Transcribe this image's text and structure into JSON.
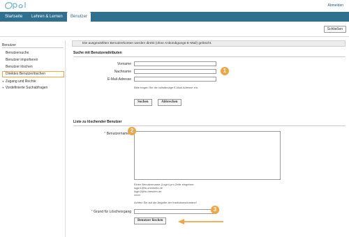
{
  "header": {
    "logo_text": "Opal",
    "logout_label": "Abmelden"
  },
  "nav": {
    "tabs": [
      {
        "label": "Startseite"
      },
      {
        "label": "Lehren & Lernen"
      },
      {
        "label": "Benutzer"
      }
    ]
  },
  "toolbar": {
    "close_label": "Schließen"
  },
  "sidebar": {
    "heading": "Benutzer",
    "items": [
      {
        "label": "Benutzersuche"
      },
      {
        "label": "Benutzer importieren"
      },
      {
        "label": "Benutzer löschen"
      },
      {
        "label": "Direktes Benutzerlöschen"
      }
    ],
    "groups": [
      {
        "toggle": "+",
        "label": "Zugang und Rechte"
      },
      {
        "toggle": "+",
        "label": "Vordefinierte Suchabfragen"
      }
    ]
  },
  "main": {
    "info_text": "Die ausgewählten Benutzerkonten werden direkt (ohne Ankündigungs-E-Mail) gelöscht.",
    "search_section": {
      "title": "Suche mit Benutzerattributen",
      "fields": [
        {
          "label": "Vorname",
          "value": ""
        },
        {
          "label": "Nachname",
          "value": ""
        },
        {
          "label": "E-Mail-Adresse",
          "value": ""
        }
      ],
      "email_hint": "Bitte tragen Sie die vollständige E-Mail-Adresse ein.",
      "search_button": "Suchen",
      "cancel_button": "Abbrechen"
    },
    "delete_section": {
      "title": "Liste zu löschender Benutzer",
      "required_marker": "*",
      "usernames_label": "Benutzernamen",
      "usernames_value": "",
      "hint_lines": [
        "Einen Benutzername (Login) pro Zeile eingeben:",
        "login1@tu-chemnitz.de",
        "login2@tu-dresden.de",
        "xxxx\\"
      ],
      "institution_hint": "Achten Sie auf die Angabe der Institutionsdomäne!",
      "reason_label": "Grund für Löschvorgang",
      "reason_value": "",
      "delete_button": "Benutzer löschen"
    }
  },
  "callouts": {
    "badge_1": "1",
    "badge_2": "2",
    "badge_3": "3",
    "accent_color": "#f0a542"
  }
}
